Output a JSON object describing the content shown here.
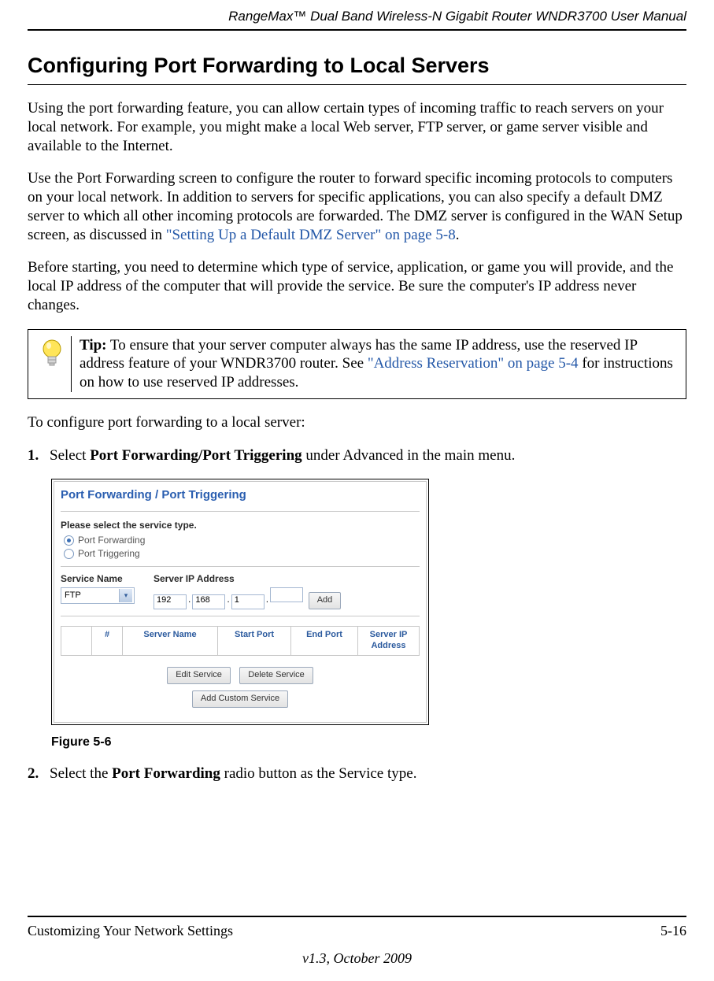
{
  "header": {
    "manual_title": "RangeMax™ Dual Band Wireless-N Gigabit Router WNDR3700 User Manual"
  },
  "heading": "Configuring Port Forwarding to Local Servers",
  "para1": "Using the port forwarding feature, you can allow certain types of incoming traffic to reach servers on your local network. For example, you might make a local Web server, FTP server, or game server visible and available to the Internet.",
  "para2_a": "Use the Port Forwarding screen to configure the router to forward specific incoming protocols to computers on your local network. In addition to servers for specific applications, you can also specify a default DMZ server to which all other incoming protocols are forwarded. The DMZ server is configured in the WAN Setup screen, as discussed in ",
  "para2_link": "\"Setting Up a Default DMZ Server\" on page 5-8",
  "para2_b": ".",
  "para3": "Before starting, you need to determine which type of service, application, or game you will provide, and the local IP address of the computer that will provide the service. Be sure the computer's IP address never changes.",
  "tip": {
    "label": "Tip:",
    "text_a": " To ensure that your server computer always has the same IP address, use the reserved IP address feature of your WNDR3700 router. See ",
    "link": "\"Address Reservation\" on page 5-4",
    "text_b": " for instructions on how to use reserved IP addresses."
  },
  "intro_steps": "To configure port forwarding to a local server:",
  "steps": {
    "s1": {
      "num": "1.",
      "a": "Select ",
      "bold": "Port Forwarding/Port Triggering",
      "b": " under Advanced in the main menu."
    },
    "s2": {
      "num": "2.",
      "a": "Select the ",
      "bold": "Port Forwarding",
      "b": " radio button as the Service type."
    }
  },
  "figure": {
    "title": "Port Forwarding / Port Triggering",
    "prompt": "Please select the service type.",
    "radio1": "Port Forwarding",
    "radio2": "Port Triggering",
    "service_name_label": "Service Name",
    "server_ip_label": "Server IP Address",
    "select_value": "FTP",
    "ip1": "192",
    "ip2": "168",
    "ip3": "1",
    "ip4": "",
    "add_btn": "Add",
    "cols": {
      "blank": " ",
      "hash": "#",
      "server_name": "Server Name",
      "start_port": "Start Port",
      "end_port": "End Port",
      "server_ip": "Server IP Address"
    },
    "edit_btn": "Edit Service",
    "delete_btn": "Delete Service",
    "custom_btn": "Add Custom Service",
    "caption": "Figure 5-6"
  },
  "footer": {
    "left": "Customizing Your Network Settings",
    "right": "5-16",
    "bottom": "v1.3, October 2009"
  }
}
